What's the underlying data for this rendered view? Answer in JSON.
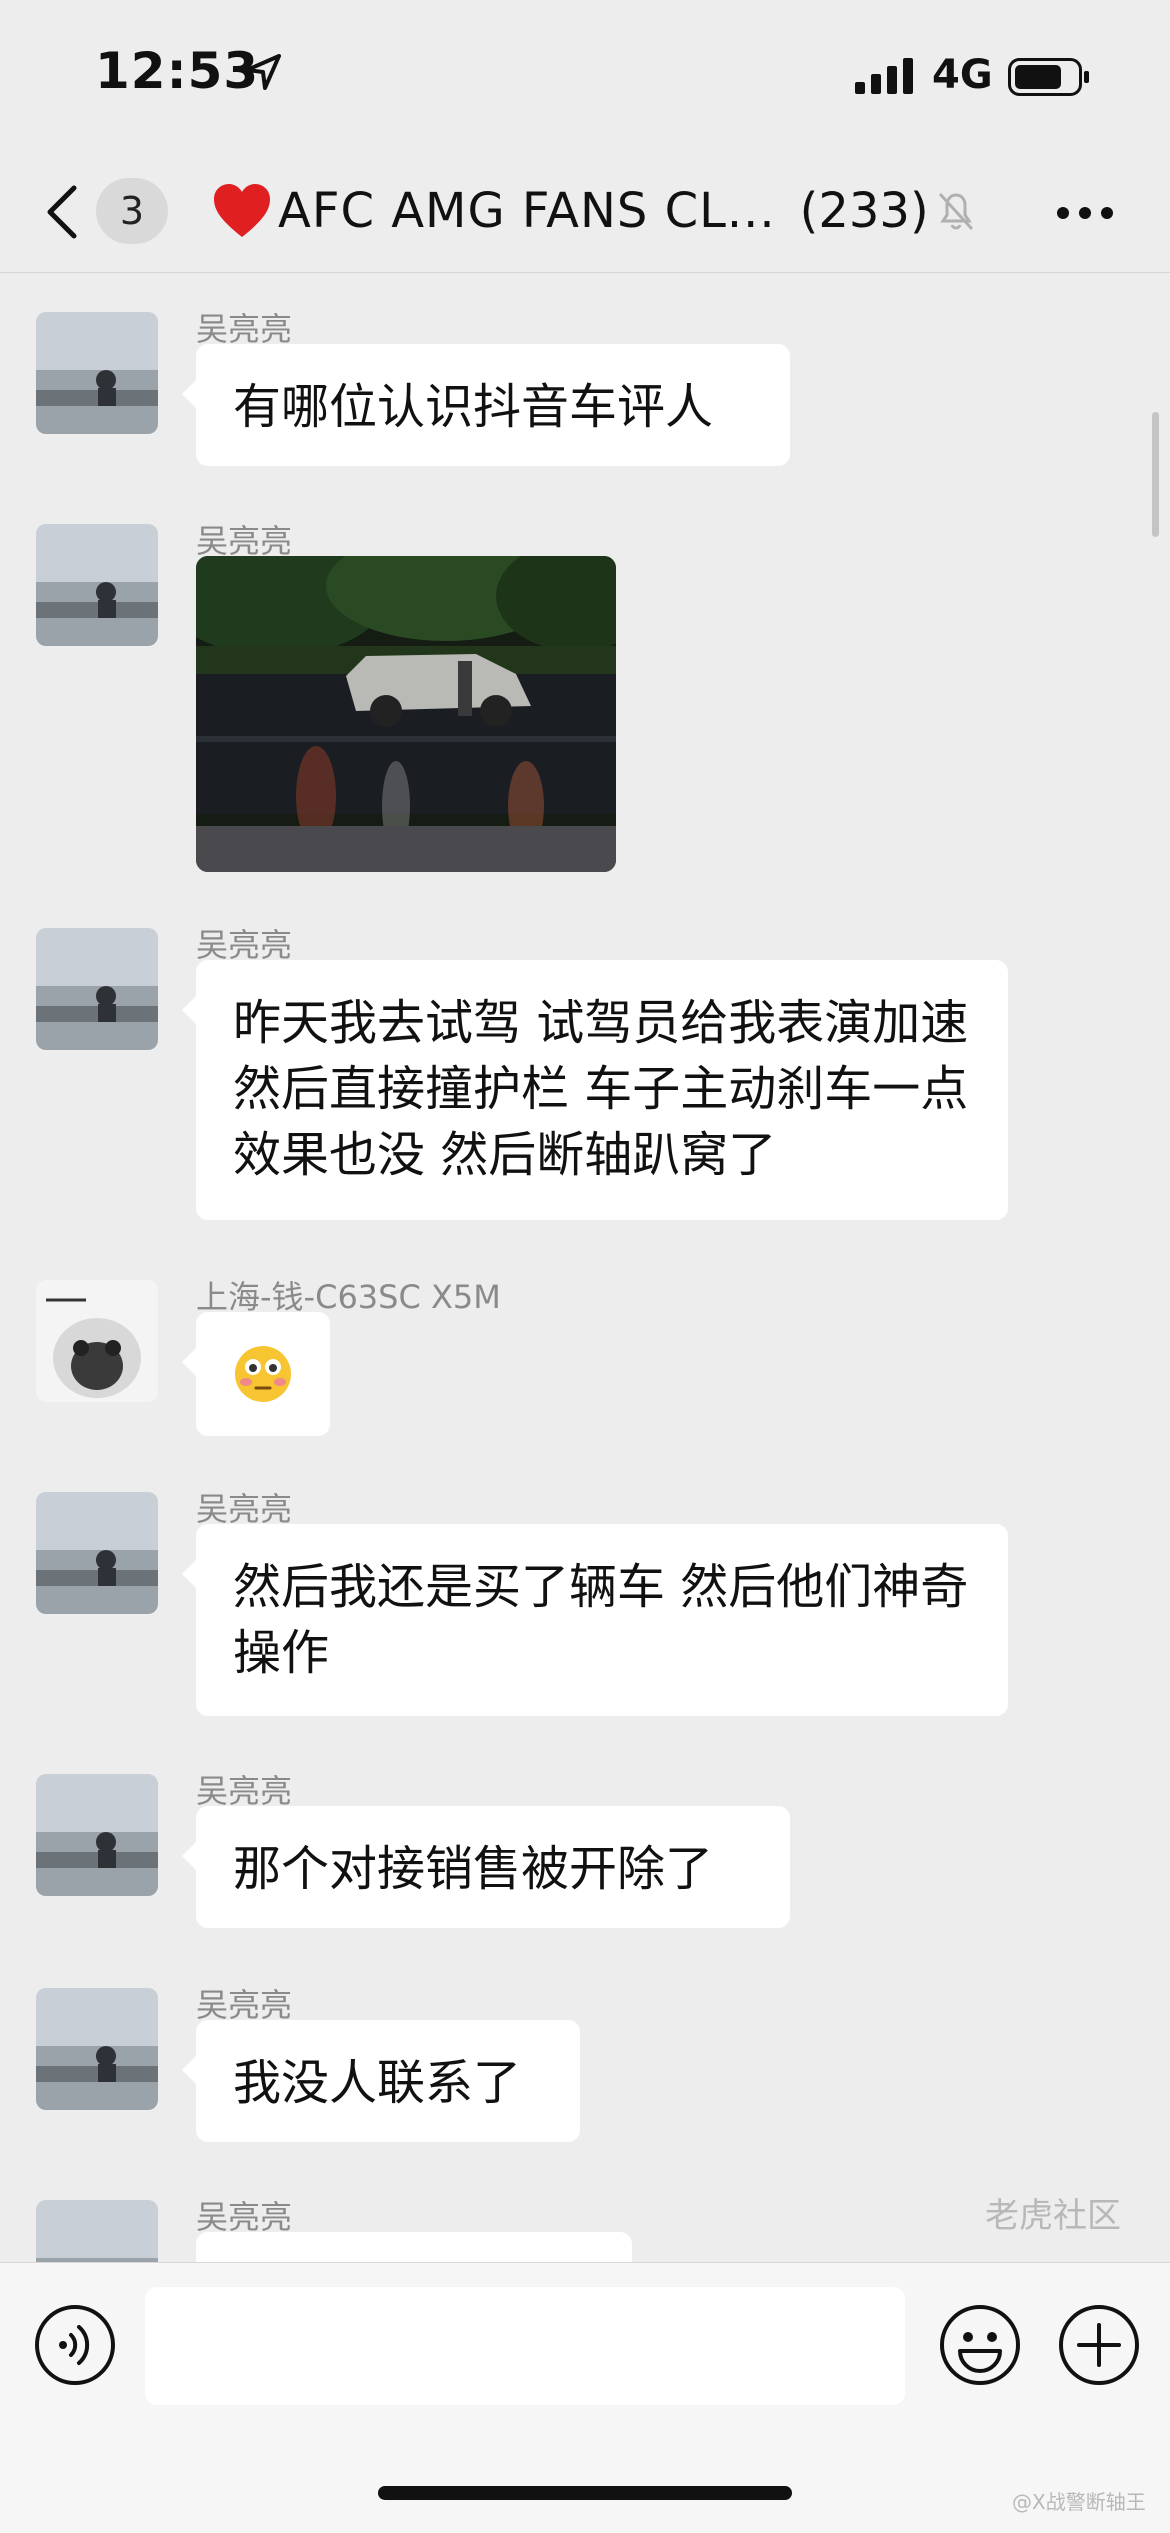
{
  "status": {
    "time": "12:53",
    "network": "4G"
  },
  "nav": {
    "unread": "3",
    "title": "AFC AMG FANS CL...",
    "count": "(233)"
  },
  "messages": [
    {
      "sender": "吴亮亮",
      "text": "有哪位认识抖音车评人"
    },
    {
      "sender": "吴亮亮",
      "image": "photo of silver SUV at night on wet road"
    },
    {
      "sender": "吴亮亮",
      "text": "昨天我去试驾 试驾员给我表演加速 然后直接撞护栏 车子主动刹车一点效果也没 然后断轴趴窝了"
    },
    {
      "sender": "上海-钱-C63SC X5M",
      "emoji": "😳"
    },
    {
      "sender": "吴亮亮",
      "text": "然后我还是买了辆车 然后他们神奇操作"
    },
    {
      "sender": "吴亮亮",
      "text": "那个对接销售被开除了"
    },
    {
      "sender": "吴亮亮",
      "text": "我没人联系了"
    },
    {
      "sender": "吴亮亮"
    }
  ],
  "watermark": {
    "main": "老虎社区",
    "sub": "@X战警断轴王"
  },
  "colors": {
    "bg": "#ededed",
    "bubble": "#ffffff",
    "accent_heart": "#e02020"
  }
}
